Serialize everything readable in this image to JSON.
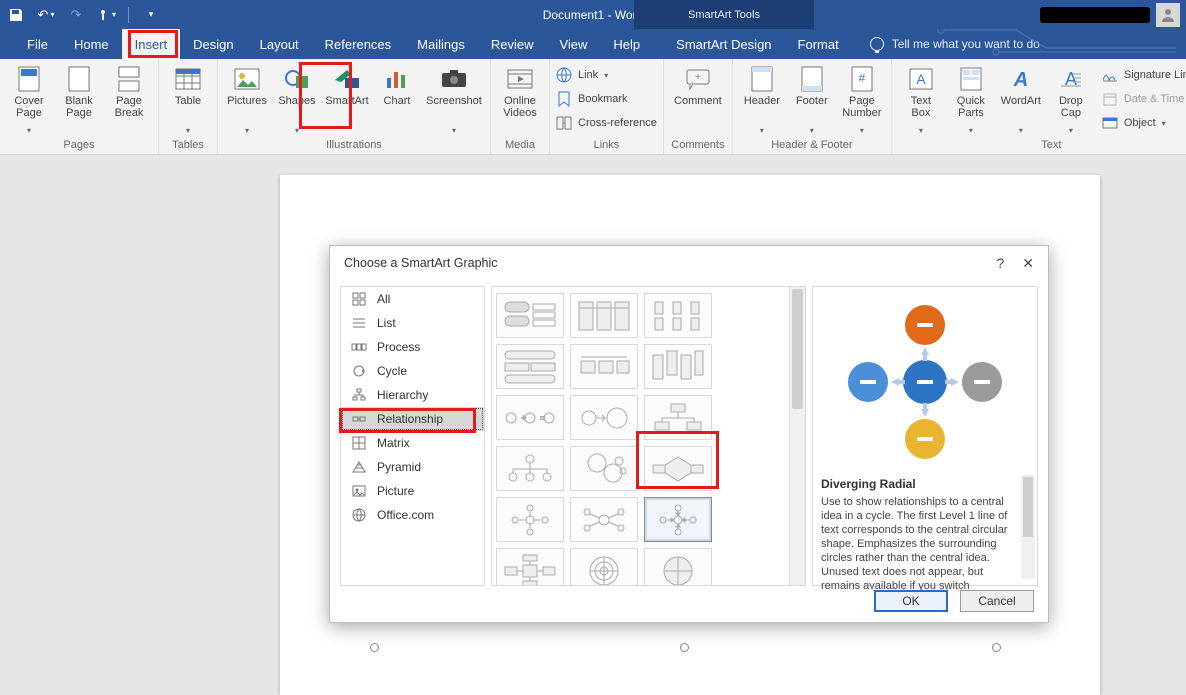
{
  "title": "Document1 - Word",
  "smartart_tools": "SmartArt Tools",
  "tabs": {
    "file": "File",
    "home": "Home",
    "insert": "Insert",
    "design": "Design",
    "layout": "Layout",
    "references": "References",
    "mailings": "Mailings",
    "review": "Review",
    "view": "View",
    "help": "Help",
    "sa_design": "SmartArt Design",
    "format": "Format"
  },
  "tell_me": "Tell me what you want to do",
  "ribbon": {
    "pages": {
      "label": "Pages",
      "cover": "Cover\nPage",
      "blank": "Blank\nPage",
      "break": "Page\nBreak"
    },
    "tables": {
      "label": "Tables",
      "table": "Table"
    },
    "illustrations": {
      "label": "Illustrations",
      "pictures": "Pictures",
      "shapes": "Shapes",
      "smartart": "SmartArt",
      "chart": "Chart",
      "screenshot": "Screenshot"
    },
    "media": {
      "label": "Media",
      "online_videos": "Online\nVideos"
    },
    "links": {
      "label": "Links",
      "link": "Link",
      "bookmark": "Bookmark",
      "crossref": "Cross-reference"
    },
    "comments": {
      "label": "Comments",
      "comment": "Comment"
    },
    "hf": {
      "label": "Header & Footer",
      "header": "Header",
      "footer": "Footer",
      "pagenum": "Page\nNumber"
    },
    "text": {
      "label": "Text",
      "textbox": "Text\nBox",
      "quickparts": "Quick\nParts",
      "wordart": "WordArt",
      "dropcap": "Drop\nCap",
      "sig": "Signature Line",
      "date": "Date & Time",
      "object": "Object"
    }
  },
  "dialog": {
    "title": "Choose a SmartArt Graphic",
    "help": "?",
    "close": "✕",
    "categories": [
      "All",
      "List",
      "Process",
      "Cycle",
      "Hierarchy",
      "Relationship",
      "Matrix",
      "Pyramid",
      "Picture",
      "Office.com"
    ],
    "selected_category_index": 5,
    "preview": {
      "name": "Diverging Radial",
      "desc": "Use to show relationships to a central idea in a cycle. The first Level 1 line of text corresponds to the central circular shape. Emphasizes the surrounding circles rather than the central idea. Unused text does not appear, but remains available if you switch"
    },
    "ok": "OK",
    "cancel": "Cancel"
  }
}
